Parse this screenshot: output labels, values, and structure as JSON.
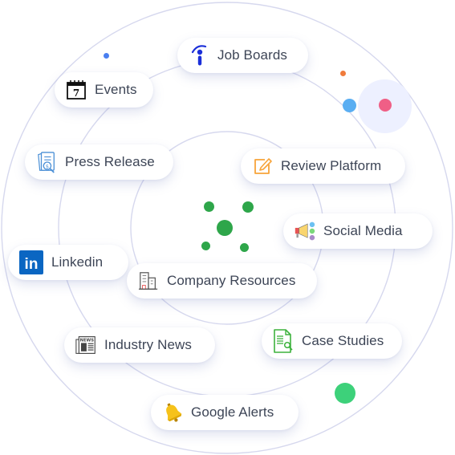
{
  "diagram": {
    "center_label": "",
    "sources": [
      {
        "id": "job-boards",
        "label": "Job Boards",
        "icon": "indeed-icon"
      },
      {
        "id": "events",
        "label": "Events",
        "icon": "calendar-icon",
        "icon_text": "7"
      },
      {
        "id": "press-release",
        "label": "Press Release",
        "icon": "press-release-icon"
      },
      {
        "id": "review-platform",
        "label": "Review Platform",
        "icon": "edit-icon"
      },
      {
        "id": "social-media",
        "label": "Social Media",
        "icon": "megaphone-icon"
      },
      {
        "id": "linkedin",
        "label": "Linkedin",
        "icon": "linkedin-icon",
        "icon_text": "in"
      },
      {
        "id": "company-resources",
        "label": "Company Resources",
        "icon": "building-icon"
      },
      {
        "id": "industry-news",
        "label": "Industry News",
        "icon": "newspaper-icon",
        "icon_text": "NEWS"
      },
      {
        "id": "case-studies",
        "label": "Case Studies",
        "icon": "document-search-icon"
      },
      {
        "id": "google-alerts",
        "label": "Google Alerts",
        "icon": "bell-icon"
      }
    ]
  },
  "colors": {
    "ring": "#d6d8ee",
    "text": "#3d4556",
    "center_dots": "#2ea64a",
    "accent_green": "#3dd17a",
    "accent_blue": "#5aaef2",
    "accent_pink": "#ef5f86",
    "accent_orange": "#f07b3c",
    "accent_dark_blue": "#4a7ff0",
    "halo": "#edf0ff",
    "indeed_blue": "#1b2fd9",
    "linkedin_blue": "#0a66c2",
    "review_orange": "#f7a43a",
    "case_green": "#3db23d",
    "bell_yellow": "#f6c21a"
  }
}
